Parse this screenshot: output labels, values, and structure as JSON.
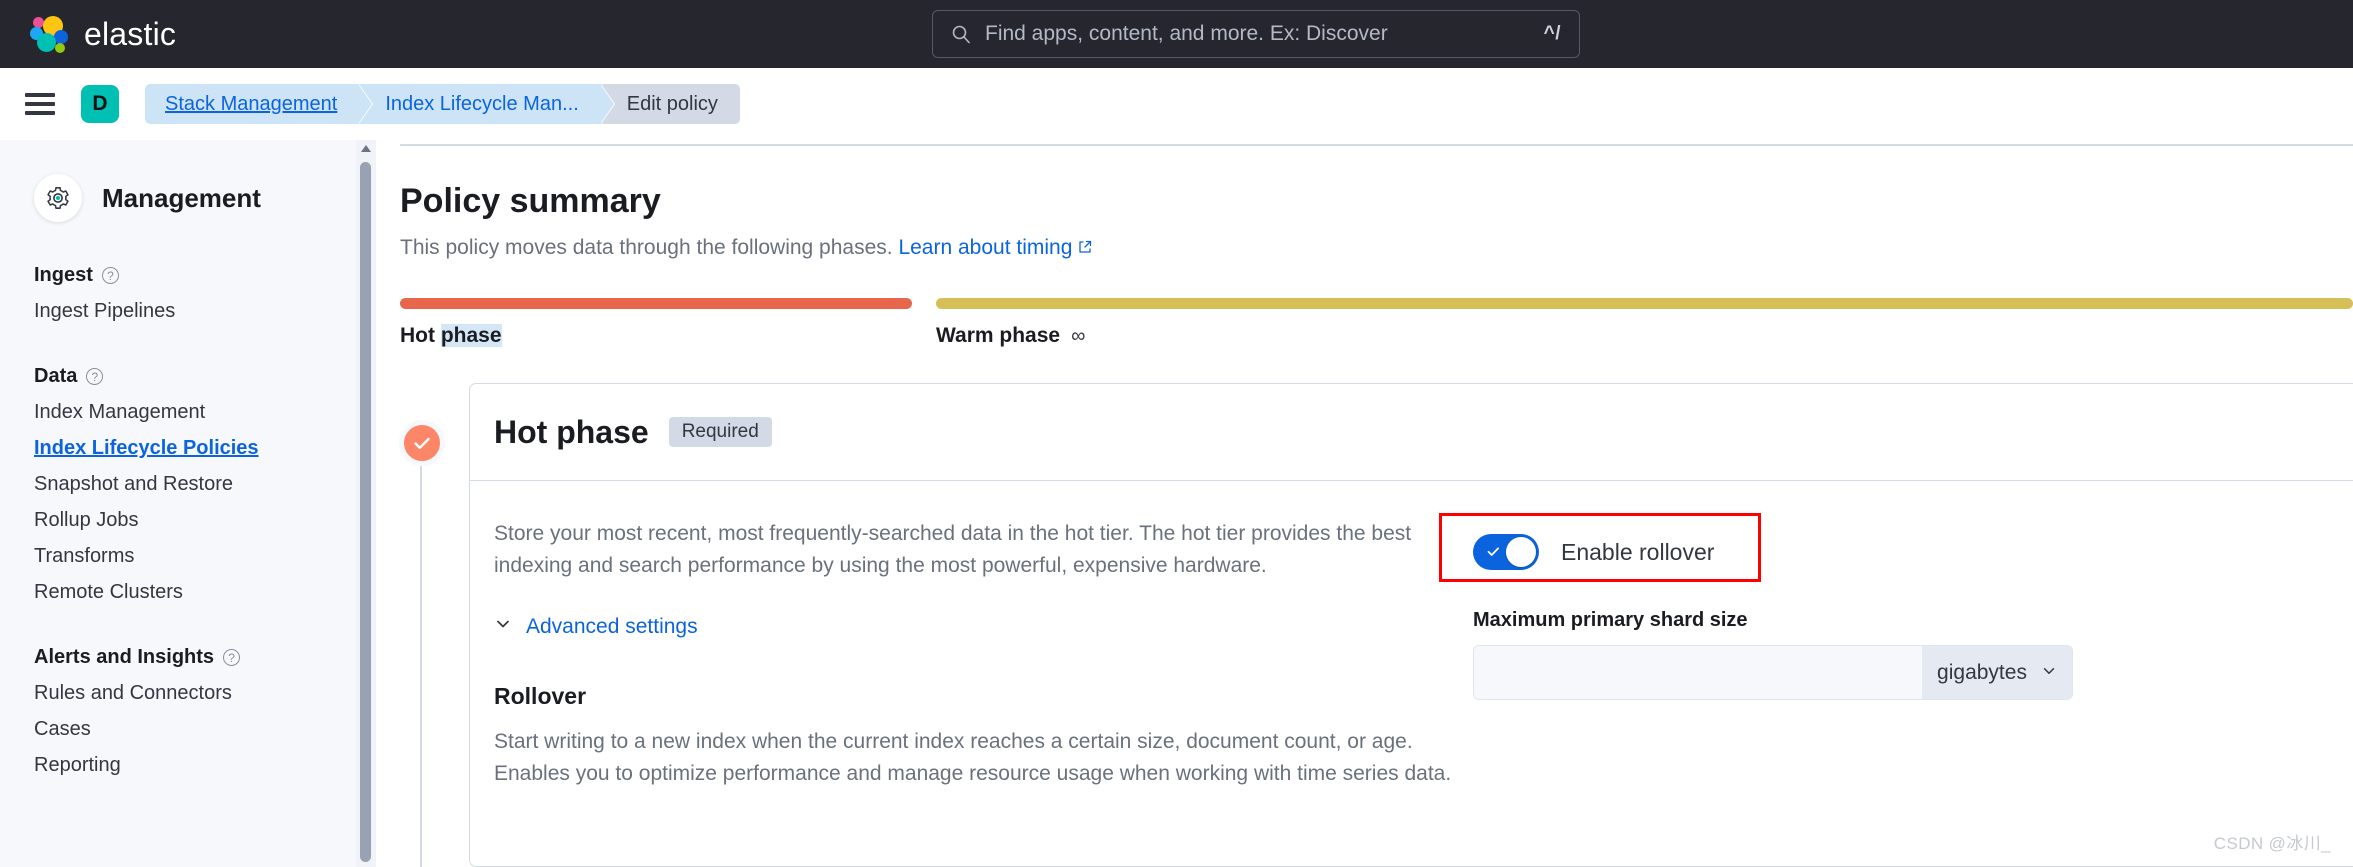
{
  "header": {
    "brand": "elastic",
    "logo_colors": [
      "#ee5097",
      "#fec514",
      "#1ba9f5",
      "#0b64dd",
      "#00bfb3",
      "#93c90e"
    ],
    "background": "#25262e",
    "search": {
      "placeholder": "Find apps, content, and more. Ex: Discover",
      "value": "",
      "shortcut": "^/"
    }
  },
  "breadcrumb": {
    "avatar_initial": "D",
    "items": [
      {
        "label": "Stack Management",
        "style": "link"
      },
      {
        "label": "Index Lifecycle Man...",
        "style": "blue"
      },
      {
        "label": "Edit policy",
        "style": "current"
      }
    ]
  },
  "sidebar": {
    "title": "Management",
    "groups": [
      {
        "label": "Ingest",
        "has_help": true,
        "items": [
          {
            "label": "Ingest Pipelines",
            "active": false
          }
        ]
      },
      {
        "label": "Data",
        "has_help": true,
        "items": [
          {
            "label": "Index Management",
            "active": false
          },
          {
            "label": "Index Lifecycle Policies",
            "active": true
          },
          {
            "label": "Snapshot and Restore",
            "active": false
          },
          {
            "label": "Rollup Jobs",
            "active": false
          },
          {
            "label": "Transforms",
            "active": false
          },
          {
            "label": "Remote Clusters",
            "active": false
          }
        ]
      },
      {
        "label": "Alerts and Insights",
        "has_help": true,
        "items": [
          {
            "label": "Rules and Connectors",
            "active": false
          },
          {
            "label": "Cases",
            "active": false
          },
          {
            "label": "Reporting",
            "active": false
          }
        ]
      }
    ]
  },
  "main": {
    "title": "Policy summary",
    "subtitle_text": "This policy moves data through the following phases.",
    "subtitle_link": "Learn about timing",
    "phases": [
      {
        "name": "Hot phase",
        "color": "#e7664c",
        "selected_word": "phase",
        "retention": ""
      },
      {
        "name": "Warm phase",
        "color": "#d6bf57",
        "retention": "∞"
      }
    ],
    "hot_phase": {
      "title": "Hot phase",
      "badge": "Required",
      "description": "Store your most recent, most frequently-searched data in the hot tier. The hot tier provides the best indexing and search performance by using the most powerful, expensive hardware.",
      "advanced_settings_label": "Advanced settings",
      "rollover": {
        "title": "Rollover",
        "description": "Start writing to a new index when the current index reaches a certain size, document count, or age. Enables you to optimize performance and manage resource usage when working with time series data.",
        "toggle_label": "Enable rollover",
        "toggle_on": true,
        "toggle_color": "#0b64dd",
        "highlight_color": "#ff0000",
        "field_label": "Maximum primary shard size",
        "field_value": "",
        "field_unit": "gigabytes"
      }
    }
  },
  "watermark": "CSDN @冰川_"
}
